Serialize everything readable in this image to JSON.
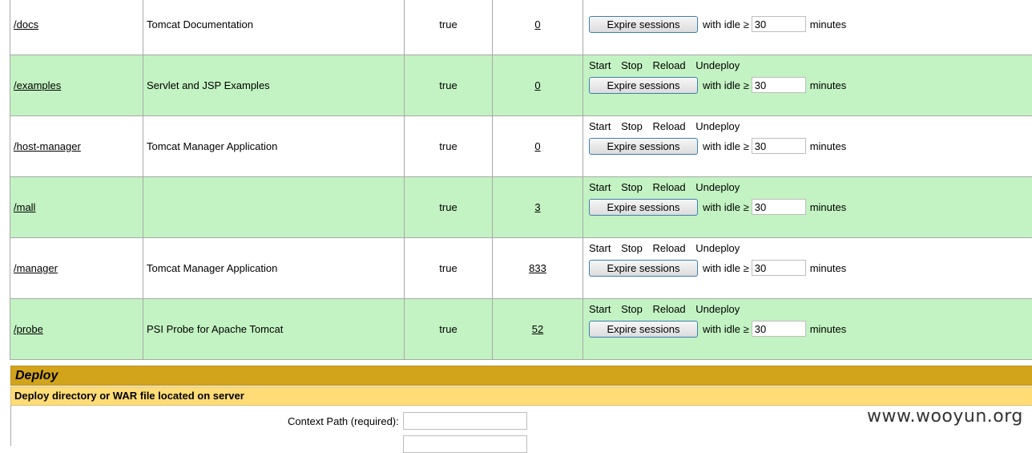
{
  "applications": [
    {
      "path": "/docs",
      "display_name": "Tomcat Documentation",
      "running": "true",
      "sessions": "0",
      "commands_visible": false,
      "commands_linked": true
    },
    {
      "path": "/examples",
      "display_name": "Servlet and JSP Examples",
      "running": "true",
      "sessions": "0",
      "commands_visible": true,
      "commands_linked": true
    },
    {
      "path": "/host-manager",
      "display_name": "Tomcat Manager Application",
      "running": "true",
      "sessions": "0",
      "commands_visible": true,
      "commands_linked": true
    },
    {
      "path": "/mall",
      "display_name": "",
      "running": "true",
      "sessions": "3",
      "commands_visible": true,
      "commands_linked": true
    },
    {
      "path": "/manager",
      "display_name": "Tomcat Manager Application",
      "running": "true",
      "sessions": "833",
      "commands_visible": true,
      "commands_linked": false
    },
    {
      "path": "/probe",
      "display_name": "PSI Probe for Apache Tomcat",
      "running": "true",
      "sessions": "52",
      "commands_visible": true,
      "commands_linked": true
    }
  ],
  "commands": {
    "start": "Start",
    "stop": "Stop",
    "reload": "Reload",
    "undeploy": "Undeploy",
    "expire_button": "Expire sessions",
    "idle_label": "with idle ≥",
    "idle_value": "30",
    "minutes_label": "minutes"
  },
  "deploy": {
    "title": "Deploy",
    "subtitle": "Deploy directory or WAR file located on server",
    "context_path_label": "Context Path (required):",
    "context_path_value": ""
  },
  "watermark": "www.wooyun.org",
  "colors": {
    "row_alt": "#c3f3c3",
    "deploy_header": "#d2a41c",
    "deploy_sub": "#ffdc75"
  }
}
